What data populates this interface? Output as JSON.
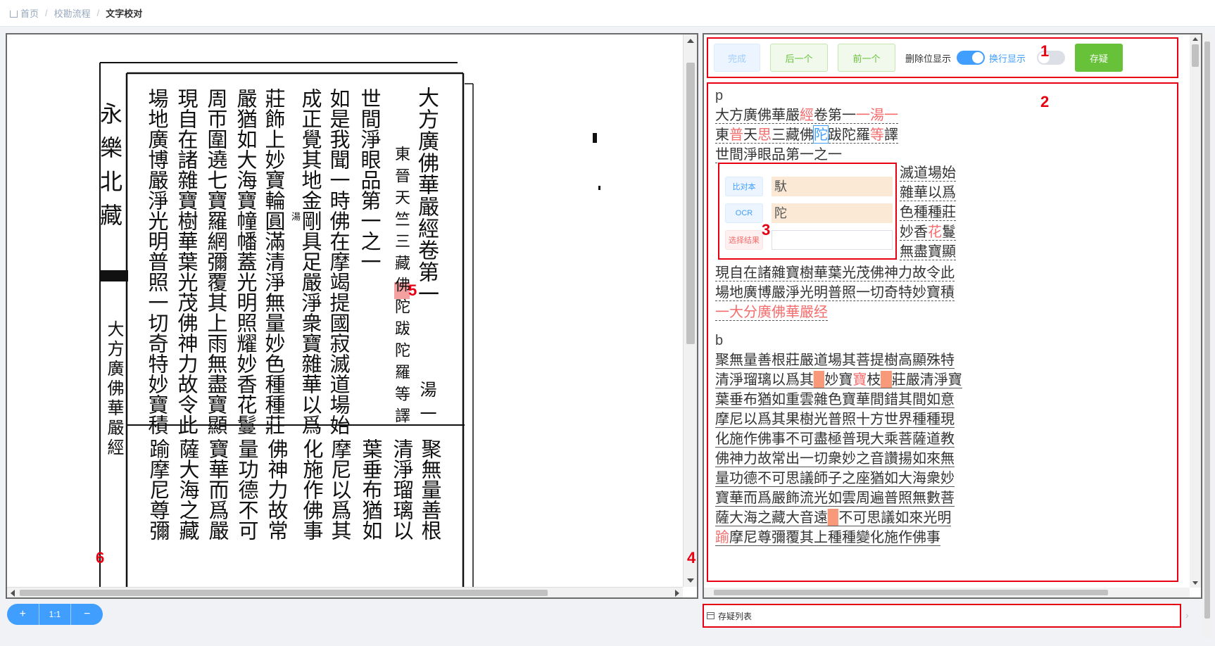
{
  "breadcrumb": [
    "首页",
    "校勘流程",
    "文字校对"
  ],
  "scan": {
    "side_title": "永樂北藏",
    "side_sub": "大方廣佛華嚴經",
    "columns_top": [
      "大方廣佛華嚴經卷第一",
      "東晉天竺三藏佛陀跋陀羅等譯",
      "世間淨眼品第一之一",
      "如是我聞一時佛在摩竭提國寂滅道場始",
      "成正覺其地金剛具足嚴淨衆寶雜華以爲",
      "莊飾上妙寶輪圓滿清淨無量妙色種種莊",
      "嚴猶如大海寶幢幡蓋光明照耀妙香花鬘",
      "周帀圍遶七寶羅網彌覆其上雨無盡寶顯",
      "現自在諸雜寶樹華葉光茂佛神力故令此",
      "場地廣博嚴淨光明普照一切奇特妙寶積"
    ],
    "tang_char": "湯一",
    "note_char": "湯",
    "columns_bottom": [
      "聚無量善根",
      "清淨瑠璃以",
      "葉垂布猶如",
      "摩尼以爲其",
      "化施作佛事",
      "佛神力故常",
      "量功德不可",
      "寶華而爲嚴",
      "薩大海之藏",
      "踰摩尼尊彌"
    ]
  },
  "toolbar": {
    "done": "完成",
    "next": "后一个",
    "prev": "前一个",
    "delete_label": "删除位显示",
    "wrap_label": "换行显示",
    "save": "存疑"
  },
  "text_blocks": {
    "tag_p": "p",
    "tag_b": "b",
    "p_line1_a": "大方廣佛華嚴",
    "p_line1_b": "經",
    "p_line1_c": "卷第一",
    "p_line1_d": "一湯一",
    "p_line2_a": "東",
    "p_line2_b": "普",
    "p_line2_c": "天",
    "p_line2_d": "思",
    "p_line2_e": "三藏佛",
    "p_line2_f": "陀",
    "p_line2_g": "跋陀羅",
    "p_line2_h": "等",
    "p_line2_i": "譯",
    "p_line3": "世間淨眼品第一之一",
    "side_lines": [
      "滅道場始",
      "雜華以爲",
      "色種種莊",
      "妙香",
      "無盡寶顯"
    ],
    "side_line4_red": "花",
    "side_line4_tail": "鬘",
    "p_line4": "現自在諸雜寶樹華葉光茂佛神力故令此",
    "p_line5": "場地廣博嚴淨光明普照一切奇特妙寶積",
    "p_line6": "一大分廣佛華嚴经",
    "b_lines": [
      "聚無量善根莊嚴道場其菩提樹高顯殊特",
      "葉垂布猶如重雲雜色寶華間錯其間如意",
      "摩尼以爲其果樹光普照十方世界種種現",
      "化施作佛事不可盡極普現大乘菩薩道教",
      "佛神力故常出一切衆妙之音讚揚如來無",
      "量功德不可思議師子之座猶如大海衆妙",
      "寶華而爲嚴飾流光如雲周遍普照無數菩"
    ],
    "b_line2_a": "清淨瑠璃以爲其",
    "b_line2_b": "妙寶",
    "b_line2_c": "寶",
    "b_line2_d": "枝",
    "b_line2_e": "莊嚴清淨寶",
    "b_line10_a": "薩大海之藏大音遠",
    "b_line10_b": "不可思議如來光明",
    "b_line11_red": "踰",
    "b_line11": "摩尼尊彌覆其上種種變化施作佛事"
  },
  "compare": {
    "label_collate": "比对本",
    "label_ocr": "OCR",
    "label_select": "选择结果",
    "collate_value": "馱",
    "ocr_value": "陀",
    "select_value": ""
  },
  "doubt_list_label": "存疑列表",
  "zoom": {
    "plus": "+",
    "reset": "1:1",
    "minus": "−"
  },
  "annotations": [
    "1",
    "2",
    "3",
    "4",
    "5",
    "6"
  ]
}
